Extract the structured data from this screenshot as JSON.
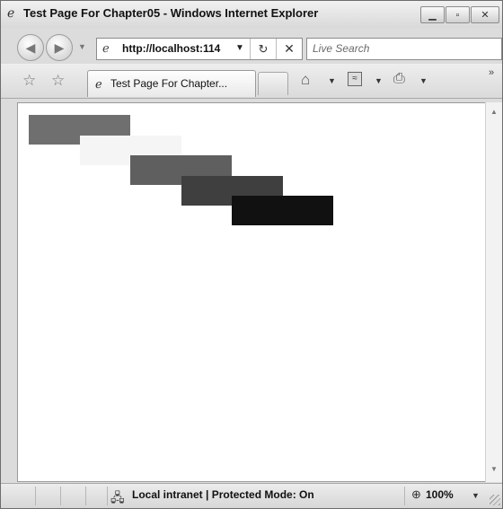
{
  "window": {
    "title": "Test Page For Chapter05 - Windows Internet Explorer",
    "title_icon": "ie-icon",
    "minimize_icon": "minimize-icon",
    "maximize_icon": "maximize-icon",
    "close_icon": "close-icon"
  },
  "address_bar": {
    "url": "http://localhost:114",
    "page_icon": "ie-page-icon",
    "refresh_icon": "refresh-icon",
    "stop_icon": "stop-icon"
  },
  "search": {
    "placeholder": "Live Search"
  },
  "tab": {
    "title": "Test Page For Chapter..."
  },
  "toolbar": {
    "icons": [
      "favorites-star-icon",
      "add-favorites-icon",
      "home-icon",
      "feeds-icon",
      "print-icon"
    ]
  },
  "content": {
    "boxes": [
      {
        "name": "gray-box",
        "color": "#6f6f6f"
      },
      {
        "name": "white-box",
        "color": "#f5f5f5"
      },
      {
        "name": "dimgray-box",
        "color": "#5f5f5f"
      },
      {
        "name": "darkgray-box",
        "color": "#3f3f3f"
      },
      {
        "name": "black-box",
        "color": "#111111"
      }
    ]
  },
  "status_bar": {
    "zone": "Local intranet | Protected Mode: On",
    "zoom": "100%"
  }
}
